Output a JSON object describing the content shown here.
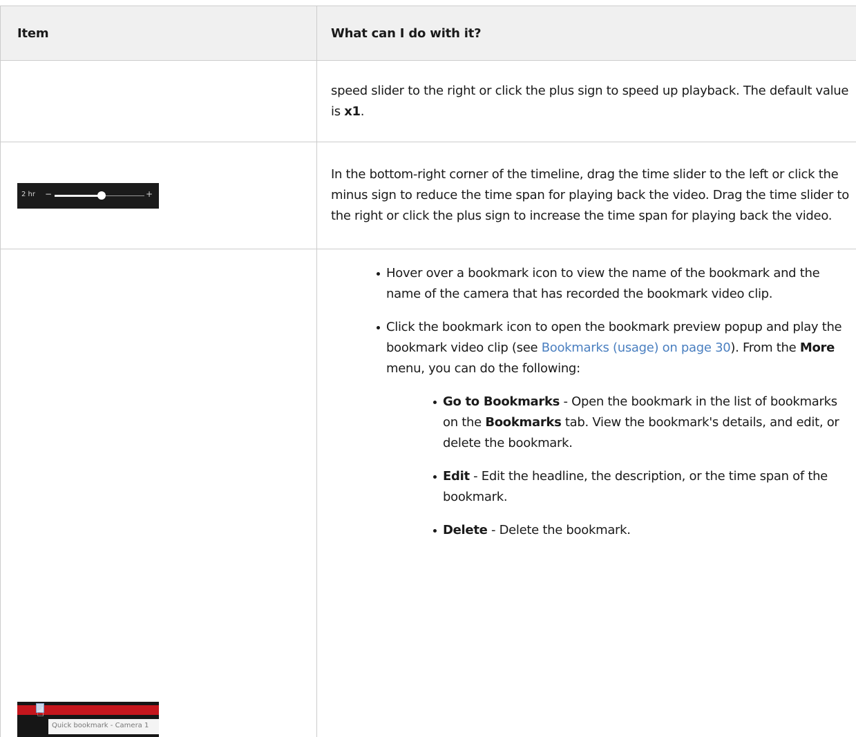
{
  "table": {
    "header": {
      "item": "Item",
      "what": "What can I do with it?"
    },
    "row_speed": {
      "text_1": "speed slider to the right or click the plus sign to speed up playback. The default value is ",
      "bold_1": "x1",
      "text_2": "."
    },
    "row_time": {
      "thumb": {
        "label": "2 hr",
        "minus": "−",
        "plus": "+",
        "slider_position_fraction": 0.5
      },
      "text": "In the bottom-right corner of the timeline, drag the time slider to the left or click the minus sign to reduce the time span for playing back the video. Drag the time slider to the right or click the plus sign to increase the time span for playing back the video."
    },
    "row_bookmark": {
      "thumb": {
        "tooltip": "Quick bookmark - Camera 1"
      },
      "bullet_1": "Hover over a bookmark icon to view the name of the bookmark and the name of the camera that has recorded the bookmark video clip.",
      "bullet_2": {
        "text_1": "Click the bookmark icon to open the bookmark preview popup and play the bookmark video clip (see ",
        "link": "Bookmarks (usage) on page 30",
        "text_2": "). From the ",
        "bold": "More",
        "text_3": " menu, you can do the following:"
      },
      "sub_items": [
        {
          "bold": "Go to Bookmarks",
          "text_1": " - Open the bookmark in the list of bookmarks on the ",
          "bold_2": "Bookmarks",
          "text_2": " tab. View the bookmark's details, and edit, or delete the bookmark."
        },
        {
          "bold": "Edit",
          "text_1": " - Edit the headline, the description, or the time span of the bookmark."
        },
        {
          "bold": "Delete",
          "text_1": " - Delete the bookmark."
        }
      ]
    }
  },
  "colors": {
    "header_bg": "#f0f0f0",
    "border": "#cccccc",
    "link": "#4a7fc0",
    "timeline_red": "#c5161d"
  }
}
